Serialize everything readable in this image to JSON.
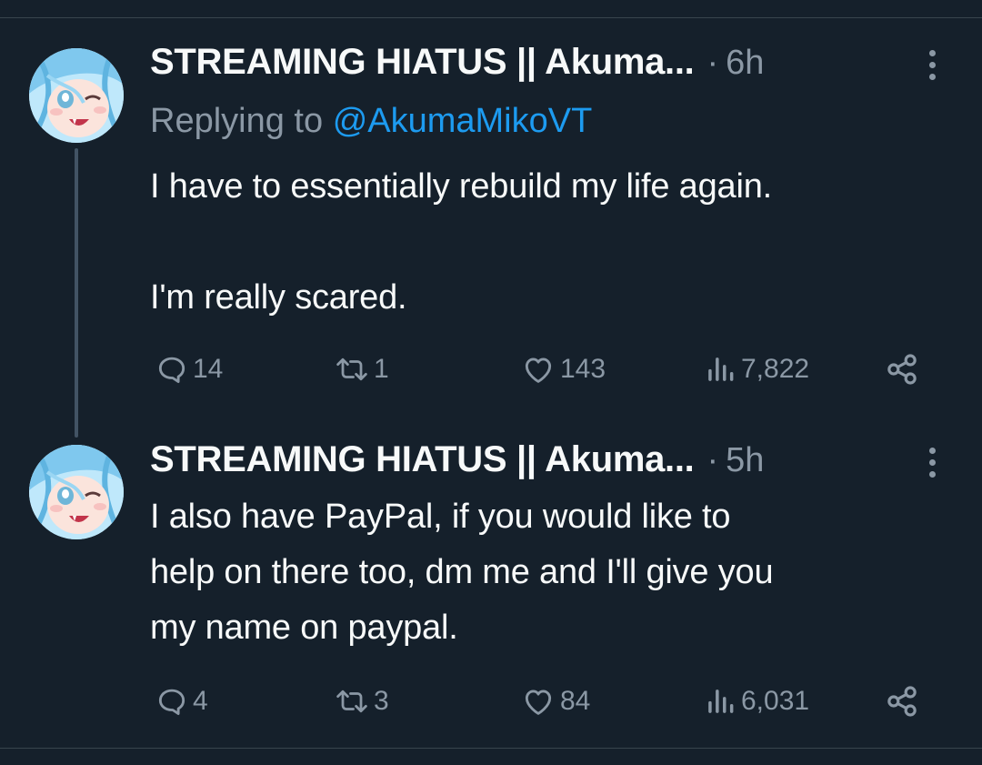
{
  "tweets": [
    {
      "author": "STREAMING HIATUS || Akuma...",
      "separator": "·",
      "time": "6h",
      "replying_prefix": "Replying to",
      "replying_handle": "@AkumaMikoVT",
      "text_lines": [
        "I have to essentially rebuild my life again.",
        "I'm really scared."
      ],
      "replies": "14",
      "retweets": "1",
      "likes": "143",
      "views": "7,822"
    },
    {
      "author": "STREAMING HIATUS || Akuma...",
      "separator": "·",
      "time": "5h",
      "text_lines": [
        "I also have PayPal, if you would like to",
        "help on there too, dm me and I'll give you",
        "my name on paypal."
      ],
      "replies": "4",
      "retweets": "3",
      "likes": "84",
      "views": "6,031"
    }
  ],
  "colors": {
    "background": "#15202b",
    "text": "#f7f9f9",
    "muted": "#8b98a5",
    "link": "#1d9bf0",
    "thread_line": "#425364"
  },
  "icons": {
    "reply": "reply-icon",
    "retweet": "retweet-icon",
    "like": "heart-icon",
    "views": "views-icon",
    "share": "share-icon",
    "more": "more-vertical-icon"
  }
}
